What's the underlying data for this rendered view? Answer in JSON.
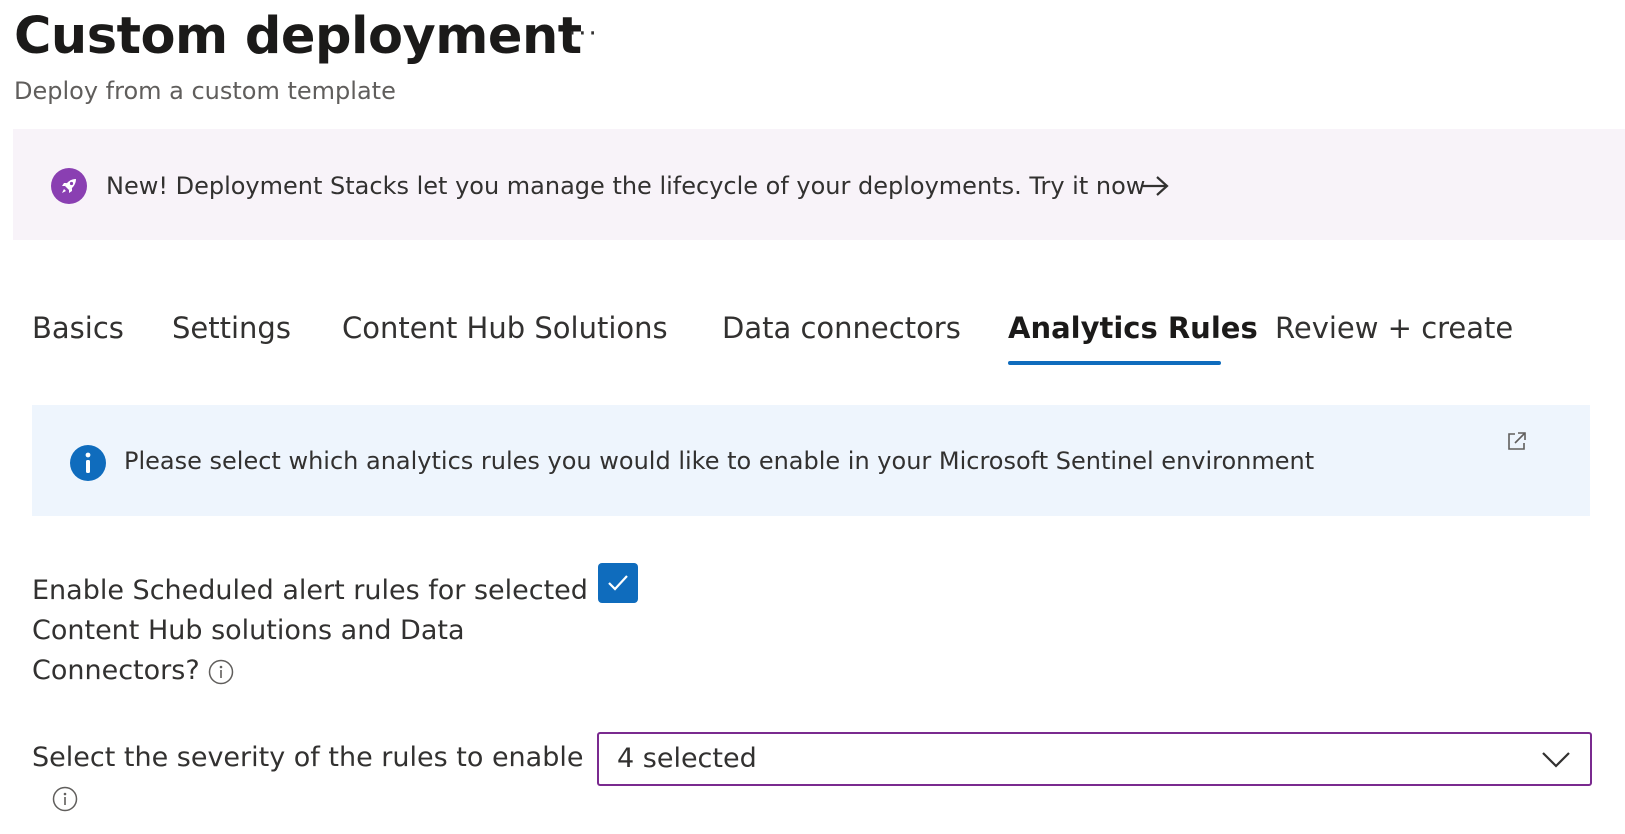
{
  "header": {
    "title": "Custom deployment",
    "more_label": "···",
    "subtitle": "Deploy from a custom template"
  },
  "promo": {
    "icon": "rocket-icon",
    "text": "New! Deployment Stacks let you manage the lifecycle of your deployments. Try it now",
    "arrow_icon": "arrow-right-icon",
    "accent_color": "#8a3fb2",
    "background_color": "#f8f3f9"
  },
  "tabs": {
    "items": [
      {
        "label": "Basics"
      },
      {
        "label": "Settings"
      },
      {
        "label": "Content Hub Solutions"
      },
      {
        "label": "Data connectors"
      },
      {
        "label": "Analytics Rules"
      },
      {
        "label": "Review + create"
      }
    ],
    "active": "Analytics Rules",
    "active_color": "#0f6cbd"
  },
  "info_bar": {
    "icon": "info-icon",
    "text": "Please select which analytics rules you would like to enable in your Microsoft Sentinel environment",
    "link_icon": "external-link-icon",
    "background_color": "#eef5fd"
  },
  "form": {
    "enable_rules": {
      "label": "Enable Scheduled alert rules for selected Content Hub solutions and Data Connectors?",
      "checked": true,
      "info_icon": "info-circle-icon"
    },
    "severity": {
      "label": "Select the severity of the rules to enable",
      "value": "4 selected",
      "info_icon": "info-circle-icon",
      "chevron_icon": "chevron-down-icon",
      "border_color": "#7a2a8f"
    }
  }
}
